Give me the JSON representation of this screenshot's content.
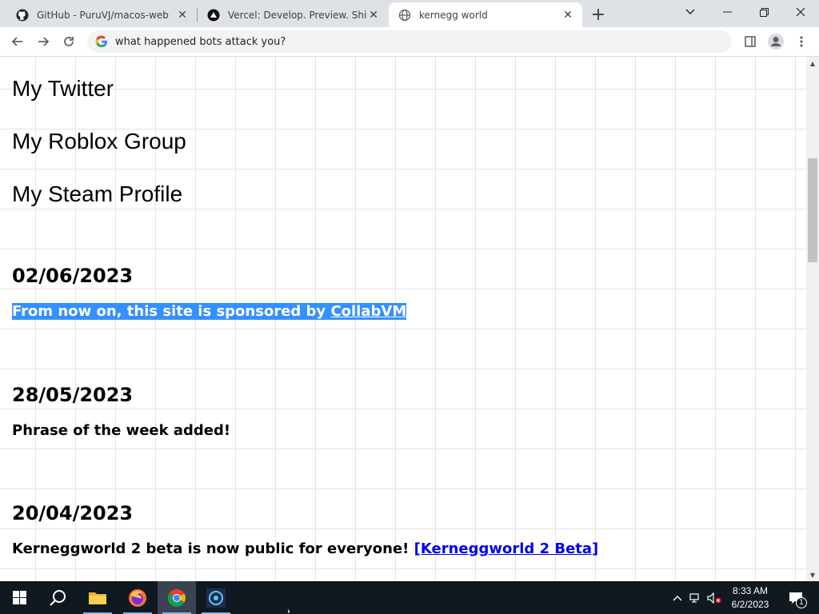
{
  "browser": {
    "tabs": [
      {
        "title": "GitHub - PuruVJ/macos-web",
        "icon": "github-icon"
      },
      {
        "title": "Vercel: Develop. Preview. Ship. For",
        "icon": "vercel-icon"
      },
      {
        "title": "kernegg world",
        "icon": "globe-icon",
        "active": true
      }
    ],
    "address_bar": {
      "value": "what happened bots attack you?"
    },
    "window_controls": [
      "tab-search-icon",
      "minimize-icon",
      "restore-icon",
      "close-icon"
    ]
  },
  "page": {
    "links": [
      "My Twitter",
      "My Roblox Group",
      "My Steam Profile"
    ],
    "updates": [
      {
        "date": "02/06/2023",
        "text": "From now on, this site is sponsored by ",
        "link": "CollabVM"
      },
      {
        "date": "28/05/2023",
        "text": "Phrase of the week added!"
      },
      {
        "date": "20/04/2023",
        "text": "Kerneggworld 2 beta is now public for everyone! ",
        "link": "[Kerneggworld 2 Beta]"
      }
    ]
  },
  "taskbar": {
    "apps": [
      "windows-start-icon",
      "search-icon",
      "file-explorer-icon",
      "firefox-icon",
      "chrome-icon",
      "app-icon"
    ],
    "clock": {
      "time": "8:33 AM",
      "date": "6/2/2023"
    },
    "notification_count": "1"
  },
  "colors": {
    "selection": "#3390ff",
    "link": "#0000ee",
    "taskbar": "#101820"
  }
}
